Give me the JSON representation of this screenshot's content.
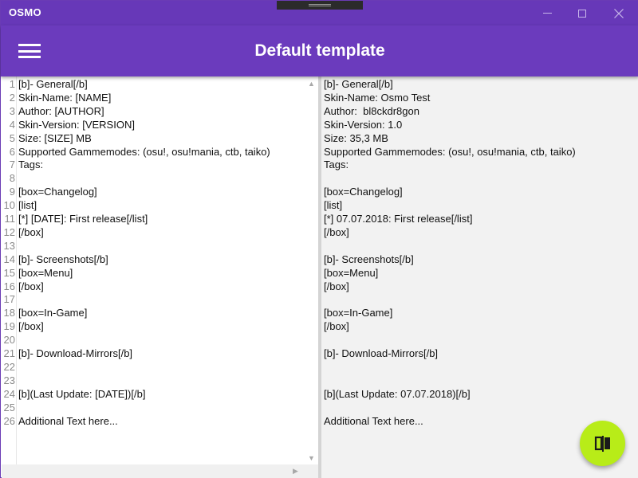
{
  "window": {
    "app_title": "OSMO",
    "controls": [
      "minimize",
      "maximize",
      "close"
    ]
  },
  "header": {
    "menu_icon": "hamburger-menu-icon",
    "title": "Default template"
  },
  "template_editor": {
    "line_numbers": [
      "1",
      "2",
      "3",
      "4",
      "5",
      "6",
      "7",
      "8",
      "9",
      "10",
      "11",
      "12",
      "13",
      "14",
      "15",
      "16",
      "17",
      "18",
      "19",
      "20",
      "21",
      "22",
      "23",
      "24",
      "25",
      "26"
    ],
    "lines": [
      "[b]- General[/b]",
      "Skin-Name: [NAME]",
      "Author: [AUTHOR]",
      "Skin-Version: [VERSION]",
      "Size: [SIZE] MB",
      "Supported Gammemodes: (osu!, osu!mania, ctb, taiko)",
      "Tags:",
      "",
      "[box=Changelog]",
      "[list]",
      "[*] [DATE]: First release[/list]",
      "[/box]",
      "",
      "[b]- Screenshots[/b]",
      "[box=Menu]",
      "[/box]",
      "",
      "[box=In-Game]",
      "[/box]",
      "",
      "[b]- Download-Mirrors[/b]",
      "",
      "",
      "[b](Last Update: [DATE])[/b]",
      "",
      "Additional Text here..."
    ]
  },
  "preview": {
    "lines": [
      "[b]- General[/b]",
      "Skin-Name: Osmo Test",
      "Author:  bl8ckdr8gon",
      "Skin-Version: 1.0",
      "Size: 35,3 MB",
      "Supported Gammemodes: (osu!, osu!mania, ctb, taiko)",
      "Tags:",
      "",
      "[box=Changelog]",
      "[list]",
      "[*] 07.07.2018: First release[/list]",
      "[/box]",
      "",
      "[b]- Screenshots[/b]",
      "[box=Menu]",
      "[/box]",
      "",
      "[box=In-Game]",
      "[/box]",
      "",
      "[b]- Download-Mirrors[/b]",
      "",
      "",
      "[b](Last Update: 07.07.2018)[/b]",
      "",
      "Additional Text here..."
    ]
  },
  "fab": {
    "icon": "swap-compare-icon"
  },
  "colors": {
    "titlebar": "#6738b8",
    "header": "#6b3bbd",
    "fab": "#b8ec18",
    "preview_bg": "#f2f2f2"
  }
}
